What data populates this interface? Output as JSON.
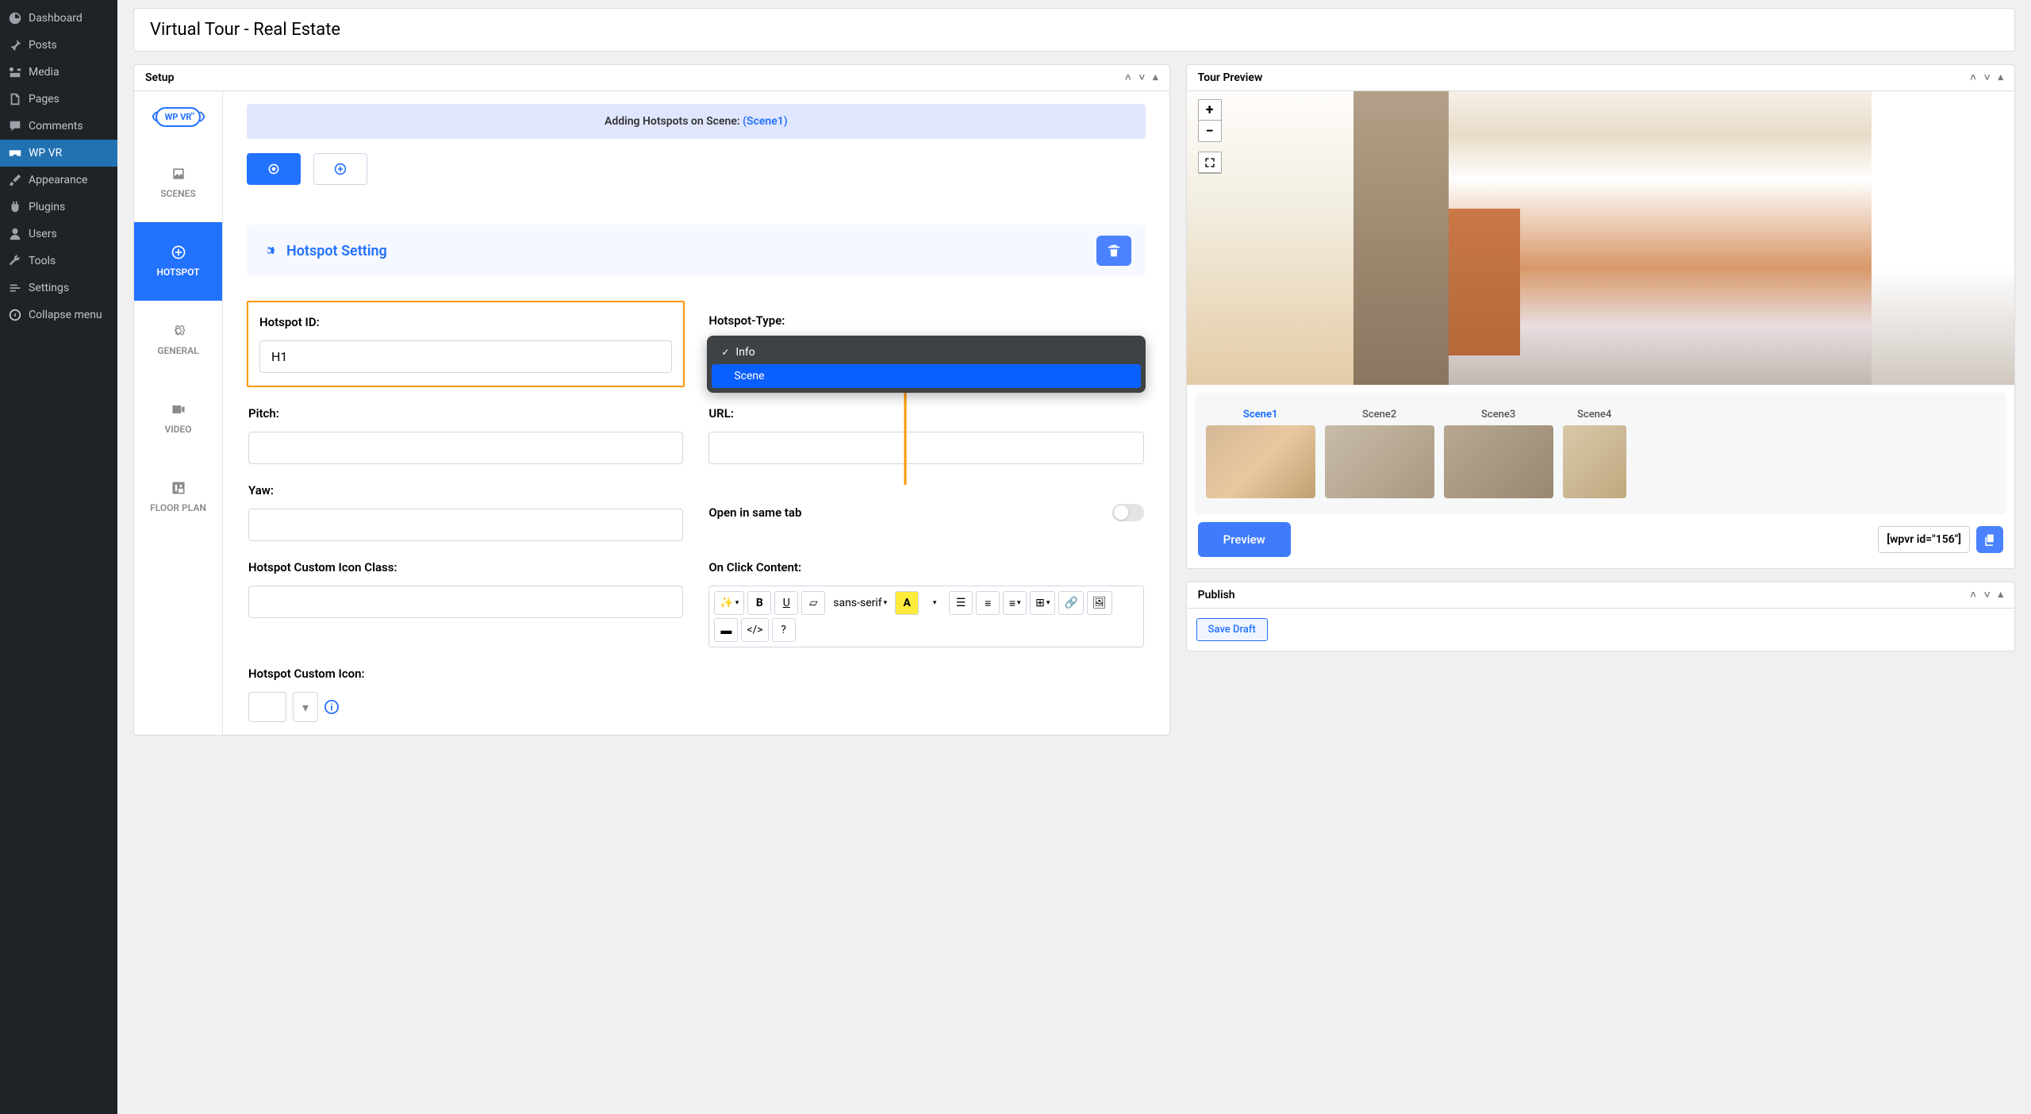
{
  "sidebar": {
    "items": [
      {
        "label": "Dashboard"
      },
      {
        "label": "Posts"
      },
      {
        "label": "Media"
      },
      {
        "label": "Pages"
      },
      {
        "label": "Comments"
      },
      {
        "label": "WP VR"
      },
      {
        "label": "Appearance"
      },
      {
        "label": "Plugins"
      },
      {
        "label": "Users"
      },
      {
        "label": "Tools"
      },
      {
        "label": "Settings"
      },
      {
        "label": "Collapse menu"
      }
    ],
    "logo_text": "WP VR"
  },
  "page_title": "Virtual Tour - Real Estate",
  "panels": {
    "setup": "Setup",
    "tour_preview": "Tour Preview",
    "publish": "Publish"
  },
  "tabs": {
    "scenes": "SCENES",
    "hotspot": "HOTSPOT",
    "general": "GENERAL",
    "video": "VIDEO",
    "floor_plan": "FLOOR PLAN"
  },
  "banner_prefix": "Adding Hotspots on Scene: ",
  "banner_scene": "(Scene1)",
  "setting_title": "Hotspot Setting",
  "form": {
    "hotspot_id_label": "Hotspot ID:",
    "hotspot_id_value": "H1",
    "hotspot_type_label": "Hotspot-Type:",
    "dropdown": {
      "opt1": "Info",
      "opt2": "Scene"
    },
    "pitch_label": "Pitch:",
    "url_label": "URL:",
    "yaw_label": "Yaw:",
    "open_same_tab_label": "Open in same tab",
    "custom_icon_class_label": "Hotspot Custom Icon Class:",
    "on_click_label": "On Click Content:",
    "custom_icon_label": "Hotspot Custom Icon:",
    "font_family": "sans-serif"
  },
  "scenes": [
    "Scene1",
    "Scene2",
    "Scene3",
    "Scene4"
  ],
  "preview_btn": "Preview",
  "shortcode": "[wpvr id=\"156\"]",
  "publish": {
    "save_draft": "Save Draft"
  }
}
